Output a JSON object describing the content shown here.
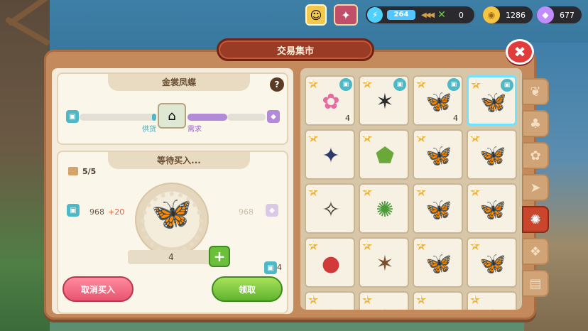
{
  "header": {
    "title": "交易集市",
    "energy_value": "264",
    "food_value": "0",
    "coins": "1286",
    "gems": "677"
  },
  "left_panel": {
    "item_name": "金裳凤蝶",
    "supply_label": "供货",
    "demand_label": "需求",
    "market_fill": 0.3,
    "waiting_title": "等待买入...",
    "slots_used": "5/5",
    "current_price": "968",
    "price_change": "+20",
    "target_price": "968",
    "quantity": "4",
    "owned_count": "4",
    "cancel_label": "取消买入",
    "claim_label": "领取"
  },
  "grid": {
    "items": [
      {
        "stars": "5",
        "qty": "4",
        "icon": "orchid-icon",
        "selected": false
      },
      {
        "stars": "5",
        "qty": "",
        "icon": "stag-beetle-icon",
        "selected": false
      },
      {
        "stars": "5",
        "qty": "4",
        "icon": "blue-butterfly-icon",
        "selected": false
      },
      {
        "stars": "5",
        "qty": "",
        "icon": "gold-butterfly-icon",
        "selected": true
      },
      {
        "stars": "4",
        "qty": "",
        "icon": "rhino-beetle-icon",
        "selected": false
      },
      {
        "stars": "4",
        "qty": "",
        "icon": "shield-bug-icon",
        "selected": false
      },
      {
        "stars": "4",
        "qty": "",
        "icon": "monarch-butterfly-icon",
        "selected": false
      },
      {
        "stars": "4",
        "qty": "",
        "icon": "luna-moth-icon",
        "selected": false
      },
      {
        "stars": "3",
        "qty": "",
        "icon": "firefly-icon",
        "selected": false
      },
      {
        "stars": "3",
        "qty": "",
        "icon": "scarab-beetle-icon",
        "selected": false
      },
      {
        "stars": "3",
        "qty": "",
        "icon": "blue-butterfly-icon",
        "selected": false
      },
      {
        "stars": "3",
        "qty": "",
        "icon": "green-butterfly-icon",
        "selected": false
      },
      {
        "stars": "2",
        "qty": "",
        "icon": "ladybug-icon",
        "selected": false
      },
      {
        "stars": "2",
        "qty": "",
        "icon": "cricket-icon",
        "selected": false
      },
      {
        "stars": "2",
        "qty": "",
        "icon": "white-butterfly-icon",
        "selected": false
      },
      {
        "stars": "2",
        "qty": "",
        "icon": "yellow-butterfly-icon",
        "selected": false
      },
      {
        "stars": "1",
        "qty": "",
        "icon": "bug-icon",
        "selected": false
      },
      {
        "stars": "1",
        "qty": "",
        "icon": "bug-icon",
        "selected": false
      },
      {
        "stars": "1",
        "qty": "",
        "icon": "bug-icon",
        "selected": false
      },
      {
        "stars": "1",
        "qty": "",
        "icon": "bug-icon",
        "selected": false
      }
    ]
  },
  "tabs": [
    {
      "name": "wheat-icon",
      "active": false
    },
    {
      "name": "crop-icon",
      "active": false
    },
    {
      "name": "flower-icon",
      "active": false
    },
    {
      "name": "fish-icon",
      "active": false
    },
    {
      "name": "beetle-icon",
      "active": true
    },
    {
      "name": "shell-icon",
      "active": false
    },
    {
      "name": "misc-icon",
      "active": false
    }
  ],
  "colors": {
    "accent_red": "#c9462d",
    "accent_green": "#5fb32f",
    "accent_pink": "#e8546f",
    "cyan": "#4fb8c6",
    "purple": "#b38ad8"
  }
}
